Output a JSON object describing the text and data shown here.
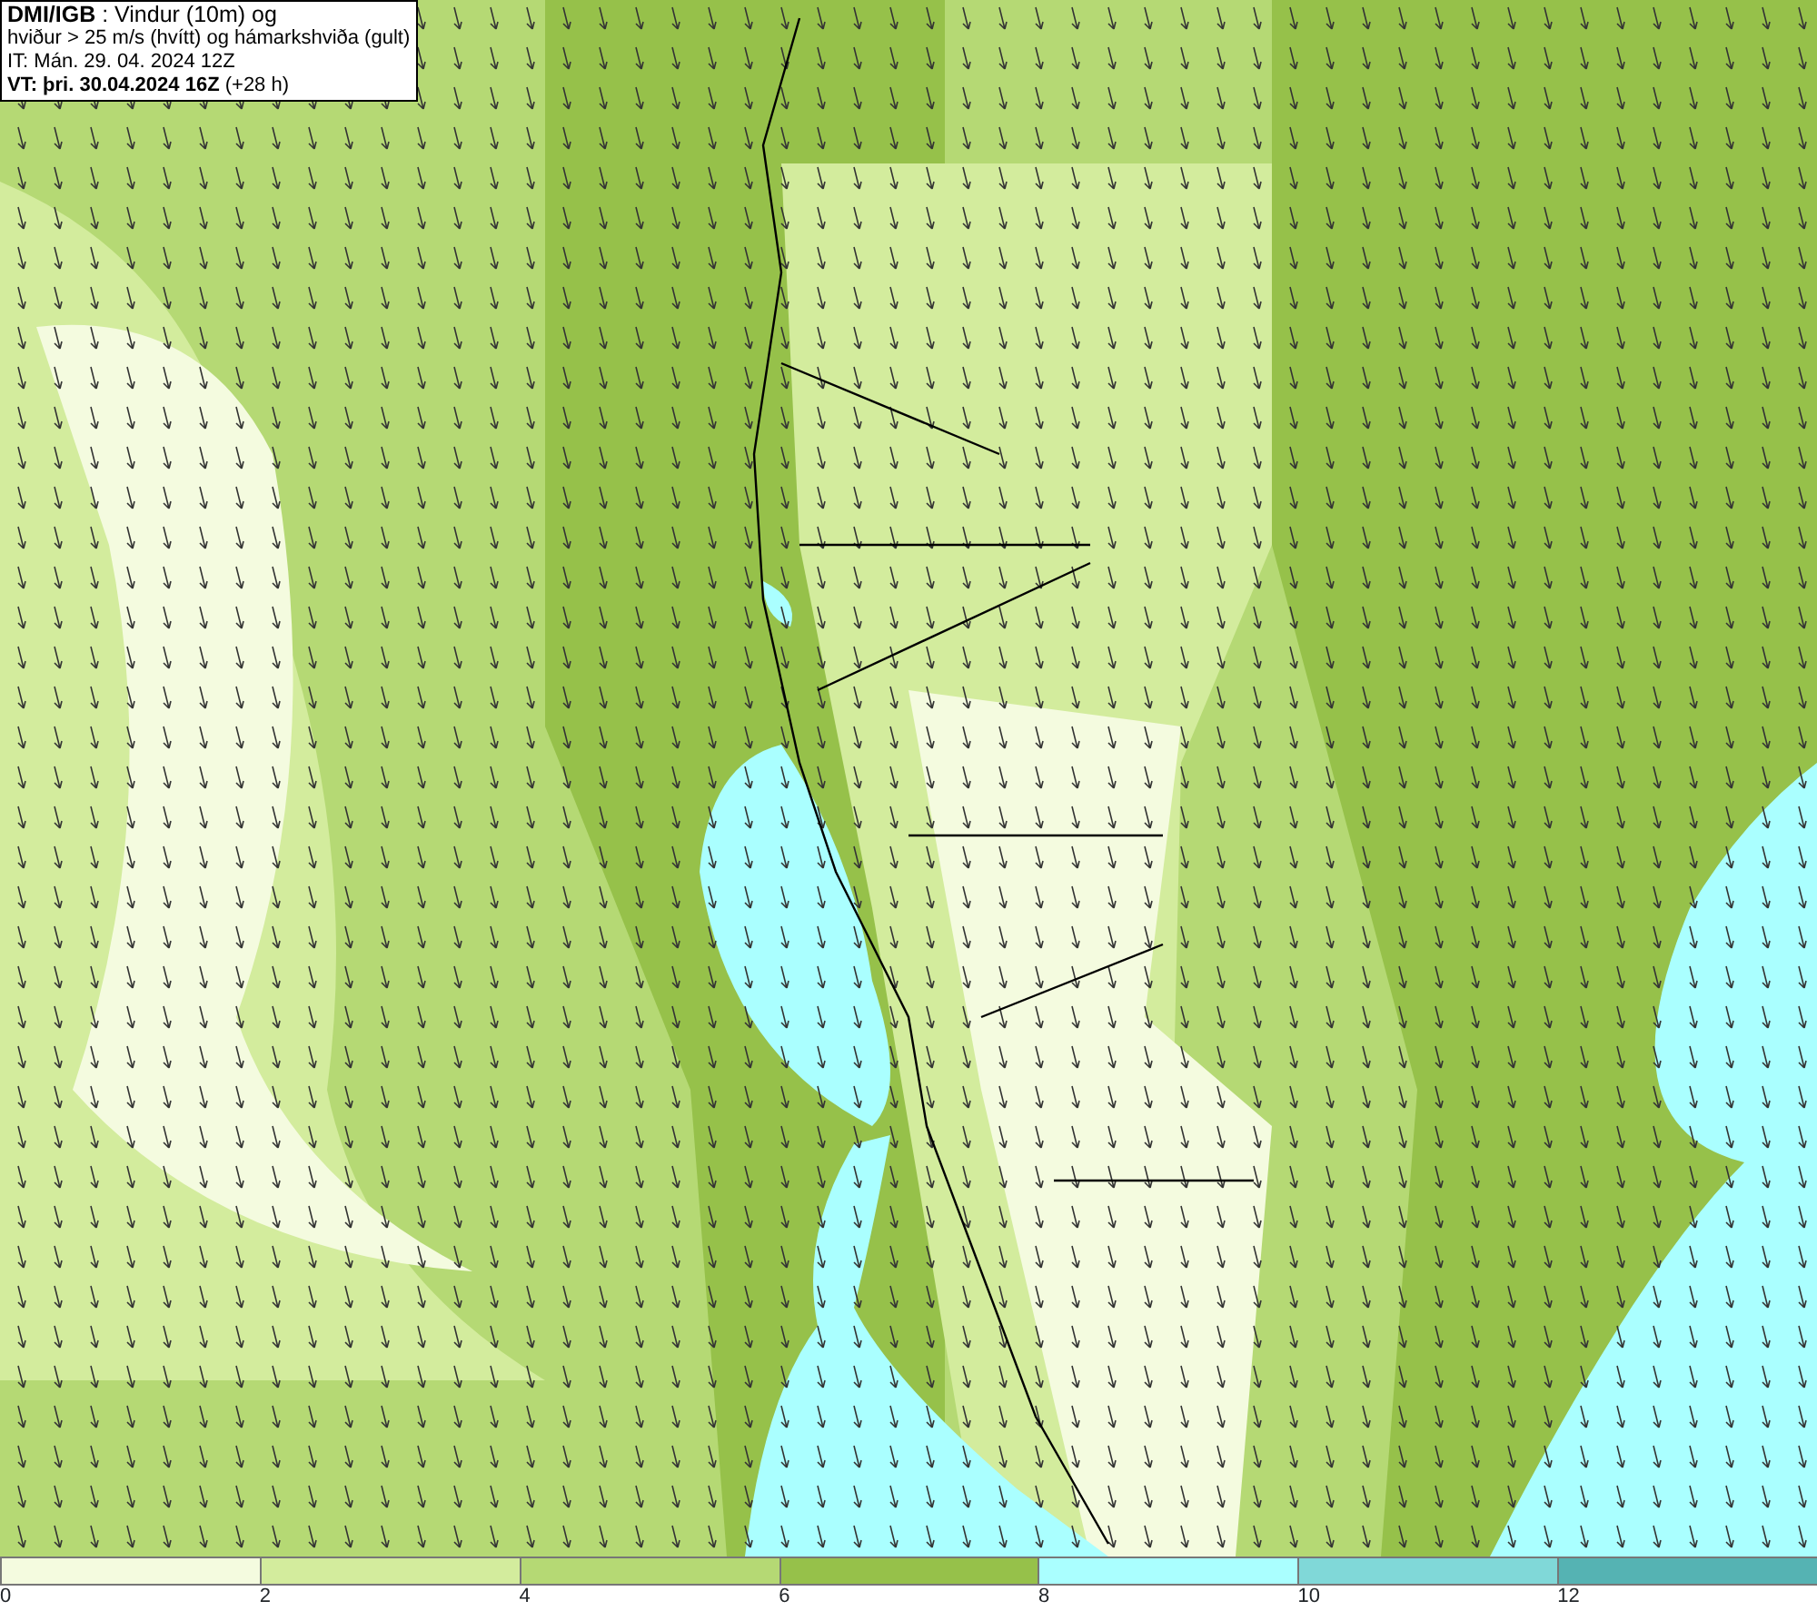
{
  "title_box": {
    "lines": [
      "**DMI/IGB** : Vindur (10m) og",
      "hviður > 25 m/s (hvítt) og hámarkshviða (gult)",
      "IT: Mán. 29. 04. 2024 12Z",
      "**VT: þri. 30.04.2024 16Z** (+28 h)"
    ]
  },
  "legend": [
    {
      "label": "0",
      "color": "#f4fbdf"
    },
    {
      "label": "2",
      "color": "#d3ec9d"
    },
    {
      "label": "4",
      "color": "#b5d974"
    },
    {
      "label": "6",
      "color": "#96c14a"
    },
    {
      "label": "8",
      "color": "#aaffff"
    },
    {
      "label": "10",
      "color": "#80d8d8"
    },
    {
      "label": "12",
      "color": "#55b3b3"
    }
  ]
}
